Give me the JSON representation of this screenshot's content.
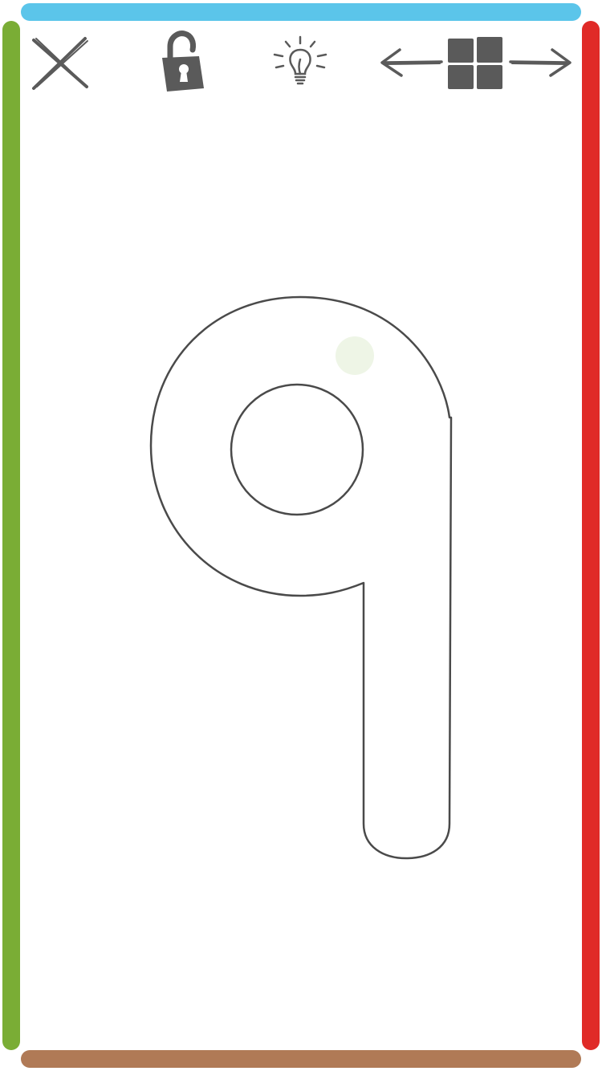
{
  "app": {
    "screen": "tracing"
  },
  "colors": {
    "top_border": "#5bc5ea",
    "left_border": "#7aad35",
    "right_border": "#e02a27",
    "bottom_border": "#b07a56",
    "icon": "#5a5a5a",
    "outline": "#4a4a4a",
    "start_dot": "#eef5e6"
  },
  "toolbar": {
    "close_icon": "close-icon",
    "lock_icon": "unlocked-padlock-icon",
    "hint_icon": "lightbulb-icon",
    "prev_icon": "arrow-left-icon",
    "menu_icon": "grid-icon",
    "next_icon": "arrow-right-icon"
  },
  "tracing": {
    "character": "9",
    "start_marker": "start-dot"
  }
}
